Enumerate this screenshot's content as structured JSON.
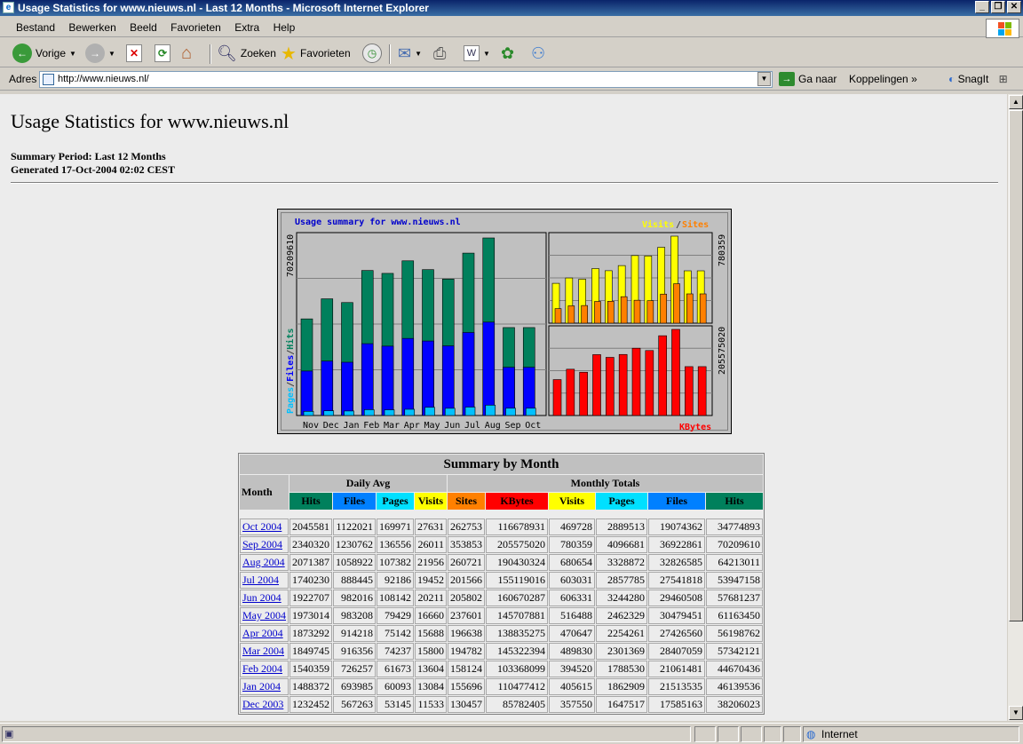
{
  "window": {
    "title": "Usage Statistics for www.nieuws.nl - Last 12 Months - Microsoft Internet Explorer"
  },
  "menu": [
    "Bestand",
    "Bewerken",
    "Beeld",
    "Favorieten",
    "Extra",
    "Help"
  ],
  "toolbar": {
    "back": "Vorige",
    "search": "Zoeken",
    "favorites": "Favorieten"
  },
  "address": {
    "label": "Adres",
    "url": "http://www.nieuws.nl/",
    "go": "Ga naar",
    "links": "Koppelingen",
    "snagit": "SnagIt"
  },
  "page": {
    "title": "Usage Statistics for www.nieuws.nl",
    "period": "Summary Period: Last 12 Months",
    "generated": "Generated 17-Oct-2004 02:02 CEST"
  },
  "graph": {
    "title": "Usage summary for www.nieuws.nl",
    "legend_visits": "Visits",
    "legend_slash": "/",
    "legend_sites": "Sites",
    "left_axis_pages": "Pages",
    "left_axis_files": "Files",
    "left_axis_hits": "Hits",
    "left_max": "70209610",
    "right_top_max": "780359",
    "right_bottom_max": "205575020",
    "kbytes_label": "KBytes",
    "colors": {
      "hits": "#00805c",
      "files": "#0000ff",
      "pages": "#00c0ff",
      "visits": "#ffff00",
      "sites": "#ff8000",
      "kbytes": "#ff0000"
    }
  },
  "chart_data": {
    "type": "bar",
    "categories": [
      "Nov",
      "Dec",
      "Jan",
      "Feb",
      "Mar",
      "Apr",
      "May",
      "Jun",
      "Jul",
      "Aug",
      "Sep",
      "Oct"
    ],
    "series": [
      {
        "name": "Hits",
        "values": [
          38206023,
          46139536,
          44670436,
          57342121,
          56198762,
          61163450,
          57681237,
          53947158,
          64213011,
          70209610,
          34774893,
          34774893
        ]
      },
      {
        "name": "Files",
        "values": [
          17585163,
          21513535,
          21061481,
          28407059,
          27426560,
          30479451,
          29460508,
          27541818,
          32826585,
          36922861,
          19074362,
          19074362
        ]
      },
      {
        "name": "Pages",
        "values": [
          1647517,
          1862909,
          1788530,
          2301369,
          2254261,
          2462329,
          3244280,
          2857785,
          3328872,
          4096681,
          2889513,
          2889513
        ]
      },
      {
        "name": "Visits",
        "values": [
          357550,
          405615,
          394520,
          489830,
          470647,
          516488,
          606331,
          603031,
          680654,
          780359,
          469728,
          469728
        ]
      },
      {
        "name": "Sites",
        "values": [
          130457,
          155696,
          158124,
          194782,
          196638,
          237601,
          205802,
          201566,
          260721,
          353853,
          262753,
          262753
        ]
      },
      {
        "name": "KBytes",
        "values": [
          85782405,
          110477412,
          103368099,
          145322394,
          138835275,
          145707881,
          160670287,
          155119016,
          190430324,
          205575020,
          116678931,
          116678931
        ]
      }
    ]
  },
  "table": {
    "caption": "Summary by Month",
    "month_header": "Month",
    "daily_avg": "Daily Avg",
    "monthly_totals": "Monthly Totals",
    "daily_cols": [
      "Hits",
      "Files",
      "Pages",
      "Visits"
    ],
    "total_cols": [
      "Sites",
      "KBytes",
      "Visits",
      "Pages",
      "Files",
      "Hits"
    ],
    "rows": [
      [
        "Oct 2004",
        "2045581",
        "1122021",
        "169971",
        "27631",
        "262753",
        "116678931",
        "469728",
        "2889513",
        "19074362",
        "34774893"
      ],
      [
        "Sep 2004",
        "2340320",
        "1230762",
        "136556",
        "26011",
        "353853",
        "205575020",
        "780359",
        "4096681",
        "36922861",
        "70209610"
      ],
      [
        "Aug 2004",
        "2071387",
        "1058922",
        "107382",
        "21956",
        "260721",
        "190430324",
        "680654",
        "3328872",
        "32826585",
        "64213011"
      ],
      [
        "Jul 2004",
        "1740230",
        "888445",
        "92186",
        "19452",
        "201566",
        "155119016",
        "603031",
        "2857785",
        "27541818",
        "53947158"
      ],
      [
        "Jun 2004",
        "1922707",
        "982016",
        "108142",
        "20211",
        "205802",
        "160670287",
        "606331",
        "3244280",
        "29460508",
        "57681237"
      ],
      [
        "May 2004",
        "1973014",
        "983208",
        "79429",
        "16660",
        "237601",
        "145707881",
        "516488",
        "2462329",
        "30479451",
        "61163450"
      ],
      [
        "Apr 2004",
        "1873292",
        "914218",
        "75142",
        "15688",
        "196638",
        "138835275",
        "470647",
        "2254261",
        "27426560",
        "56198762"
      ],
      [
        "Mar 2004",
        "1849745",
        "916356",
        "74237",
        "15800",
        "194782",
        "145322394",
        "489830",
        "2301369",
        "28407059",
        "57342121"
      ],
      [
        "Feb 2004",
        "1540359",
        "726257",
        "61673",
        "13604",
        "158124",
        "103368099",
        "394520",
        "1788530",
        "21061481",
        "44670436"
      ],
      [
        "Jan 2004",
        "1488372",
        "693985",
        "60093",
        "13084",
        "155696",
        "110477412",
        "405615",
        "1862909",
        "21513535",
        "46139536"
      ],
      [
        "Dec 2003",
        "1232452",
        "567263",
        "53145",
        "11533",
        "130457",
        "85782405",
        "357550",
        "1647517",
        "17585163",
        "38206023"
      ]
    ]
  },
  "status": {
    "zone": "Internet"
  }
}
